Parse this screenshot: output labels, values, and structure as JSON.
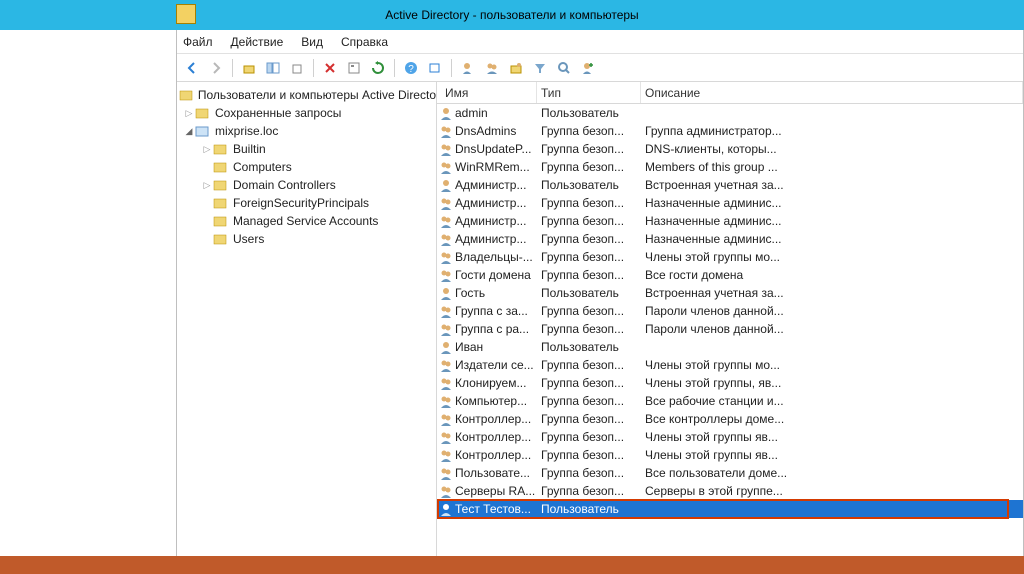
{
  "window": {
    "title": "Active Directory - пользователи и компьютеры"
  },
  "menu": {
    "file": "Файл",
    "action": "Действие",
    "view": "Вид",
    "help": "Справка"
  },
  "tree": {
    "root": "Пользователи и компьютеры Active Directo",
    "saved": "Сохраненные запросы",
    "domain": "mixprise.loc",
    "builtin": "Builtin",
    "computers": "Computers",
    "dc": "Domain Controllers",
    "fsp": "ForeignSecurityPrincipals",
    "msa": "Managed Service Accounts",
    "users": "Users"
  },
  "cols": {
    "name": "Имя",
    "type": "Тип",
    "desc": "Описание"
  },
  "rows": [
    {
      "icon": "user",
      "name": "admin",
      "type": "Пользователь",
      "desc": ""
    },
    {
      "icon": "group",
      "name": "DnsAdmins",
      "type": "Группа безоп...",
      "desc": "Группа администратор..."
    },
    {
      "icon": "group",
      "name": "DnsUpdateP...",
      "type": "Группа безоп...",
      "desc": "DNS-клиенты, которы..."
    },
    {
      "icon": "group",
      "name": "WinRMRem...",
      "type": "Группа безоп...",
      "desc": "Members of this group ..."
    },
    {
      "icon": "user",
      "name": "Администр...",
      "type": "Пользователь",
      "desc": "Встроенная учетная за..."
    },
    {
      "icon": "group",
      "name": "Администр...",
      "type": "Группа безоп...",
      "desc": "Назначенные админис..."
    },
    {
      "icon": "group",
      "name": "Администр...",
      "type": "Группа безоп...",
      "desc": "Назначенные админис..."
    },
    {
      "icon": "group",
      "name": "Администр...",
      "type": "Группа безоп...",
      "desc": "Назначенные админис..."
    },
    {
      "icon": "group",
      "name": "Владельцы-...",
      "type": "Группа безоп...",
      "desc": "Члены этой группы мо..."
    },
    {
      "icon": "group",
      "name": "Гости домена",
      "type": "Группа безоп...",
      "desc": "Все гости домена"
    },
    {
      "icon": "user",
      "name": "Гость",
      "type": "Пользователь",
      "desc": "Встроенная учетная за..."
    },
    {
      "icon": "group",
      "name": "Группа с за...",
      "type": "Группа безоп...",
      "desc": "Пароли членов данной..."
    },
    {
      "icon": "group",
      "name": "Группа с ра...",
      "type": "Группа безоп...",
      "desc": "Пароли членов данной..."
    },
    {
      "icon": "user",
      "name": "Иван",
      "type": "Пользователь",
      "desc": ""
    },
    {
      "icon": "group",
      "name": "Издатели се...",
      "type": "Группа безоп...",
      "desc": "Члены этой группы мо..."
    },
    {
      "icon": "group",
      "name": "Клонируем...",
      "type": "Группа безоп...",
      "desc": "Члены этой группы, яв..."
    },
    {
      "icon": "group",
      "name": "Компьютер...",
      "type": "Группа безоп...",
      "desc": "Все рабочие станции и..."
    },
    {
      "icon": "group",
      "name": "Контроллер...",
      "type": "Группа безоп...",
      "desc": "Все контроллеры доме..."
    },
    {
      "icon": "group",
      "name": "Контроллер...",
      "type": "Группа безоп...",
      "desc": "Члены этой группы яв..."
    },
    {
      "icon": "group",
      "name": "Контроллер...",
      "type": "Группа безоп...",
      "desc": "Члены этой группы яв..."
    },
    {
      "icon": "group",
      "name": "Пользовате...",
      "type": "Группа безоп...",
      "desc": "Все пользователи доме..."
    },
    {
      "icon": "group",
      "name": "Серверы RA...",
      "type": "Группа безоп...",
      "desc": "Серверы в этой группе..."
    },
    {
      "icon": "user",
      "name": "Тест Тестов...",
      "type": "Пользователь",
      "desc": "",
      "selected": true
    }
  ]
}
